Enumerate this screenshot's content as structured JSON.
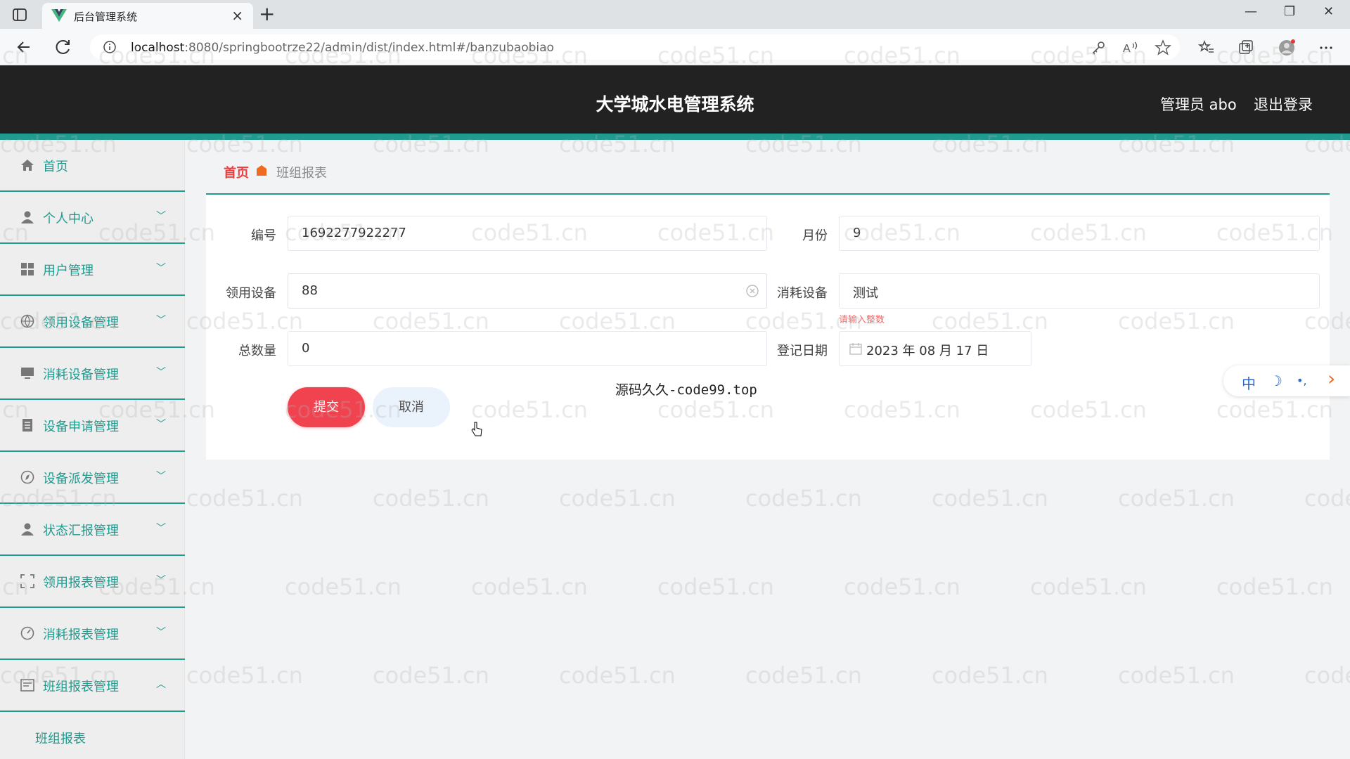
{
  "browser": {
    "tab_title": "后台管理系统",
    "url_host": "localhost",
    "url_rest": ":8080/springbootrze22/admin/dist/index.html#/banzubaobiao"
  },
  "header": {
    "title": "大学城水电管理系统",
    "user": "管理员 abo",
    "logout": "退出登录"
  },
  "sidebar": {
    "items": [
      {
        "label": "首页",
        "icon": "home-icon",
        "arrow": ""
      },
      {
        "label": "个人中心",
        "icon": "user-icon",
        "arrow": "﹀"
      },
      {
        "label": "用户管理",
        "icon": "grid-icon",
        "arrow": "﹀"
      },
      {
        "label": "领用设备管理",
        "icon": "globe-icon",
        "arrow": "﹀"
      },
      {
        "label": "消耗设备管理",
        "icon": "monitor-icon",
        "arrow": "﹀"
      },
      {
        "label": "设备申请管理",
        "icon": "document-icon",
        "arrow": "﹀"
      },
      {
        "label": "设备派发管理",
        "icon": "compass-icon",
        "arrow": "﹀"
      },
      {
        "label": "状态汇报管理",
        "icon": "person-icon",
        "arrow": "﹀"
      },
      {
        "label": "领用报表管理",
        "icon": "fullscreen-icon",
        "arrow": "﹀"
      },
      {
        "label": "消耗报表管理",
        "icon": "gauge-icon",
        "arrow": "﹀"
      },
      {
        "label": "班组报表管理",
        "icon": "list-icon",
        "arrow": "︿"
      }
    ],
    "submenu": "班组报表"
  },
  "breadcrumb": {
    "home": "首页",
    "current": "班组报表"
  },
  "form": {
    "bianhao_label": "编号",
    "bianhao_value": "1692277922277",
    "yuefen_label": "月份",
    "yuefen_value": "9",
    "lingyong_label": "领用设备",
    "lingyong_value": "88",
    "xiaohao_label": "消耗设备",
    "xiaohao_value": "测试",
    "xiaohao_error": "请输入整数",
    "zongshu_label": "总数量",
    "zongshu_value": "0",
    "riqi_label": "登记日期",
    "riqi_value": "2023 年 08 月 17 日",
    "submit": "提交",
    "cancel": "取消"
  },
  "overlay_text": "源码久久-code99.top",
  "ime": {
    "lang": "中",
    "mode": "☽",
    "punct": "•,",
    "more": "›"
  },
  "watermark": "code51.cn",
  "colors": {
    "accent": "#1f9b8f",
    "header_bg": "#222222",
    "danger": "#f0424f",
    "breadcrumb_home": "#f03c3c"
  }
}
